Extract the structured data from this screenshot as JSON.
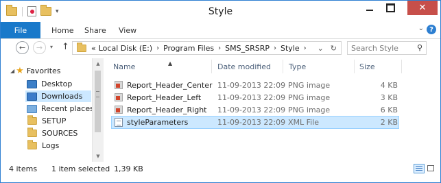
{
  "window": {
    "title": "Style"
  },
  "ribbon": {
    "file_tab": "File",
    "tabs": [
      "Home",
      "Share",
      "View"
    ],
    "help": "?"
  },
  "address": {
    "prefix": "«",
    "crumbs": [
      "Local Disk (E:)",
      "Program Files",
      "SMS_SRSRP",
      "Style"
    ]
  },
  "search": {
    "placeholder": "Search Style"
  },
  "navpane": {
    "favorites": "Favorites",
    "items": [
      "Desktop",
      "Downloads",
      "Recent places",
      "SETUP",
      "SOURCES",
      "Logs"
    ],
    "selected": "Downloads"
  },
  "columns": {
    "name": "Name",
    "date": "Date modified",
    "type": "Type",
    "size": "Size"
  },
  "files": [
    {
      "name": "Report_Header_Center",
      "date": "11-09-2013 22:09",
      "type": "PNG image",
      "size": "4 KB",
      "icon": "png-file-icon"
    },
    {
      "name": "Report_Header_Left",
      "date": "11-09-2013 22:09",
      "type": "PNG image",
      "size": "3 KB",
      "icon": "png-file-icon"
    },
    {
      "name": "Report_Header_Right",
      "date": "11-09-2013 22:09",
      "type": "PNG image",
      "size": "6 KB",
      "icon": "png-file-icon"
    },
    {
      "name": "styleParameters",
      "date": "11-09-2013 22:09",
      "type": "XML File",
      "size": "2 KB",
      "icon": "xml-file-icon",
      "selected": true
    }
  ],
  "status": {
    "items": "4 items",
    "selected": "1 item selected",
    "selected_size": "1,39 KB"
  },
  "colors": {
    "accent": "#1979ca",
    "selection": "#cce8ff",
    "close": "#c74f4a"
  }
}
